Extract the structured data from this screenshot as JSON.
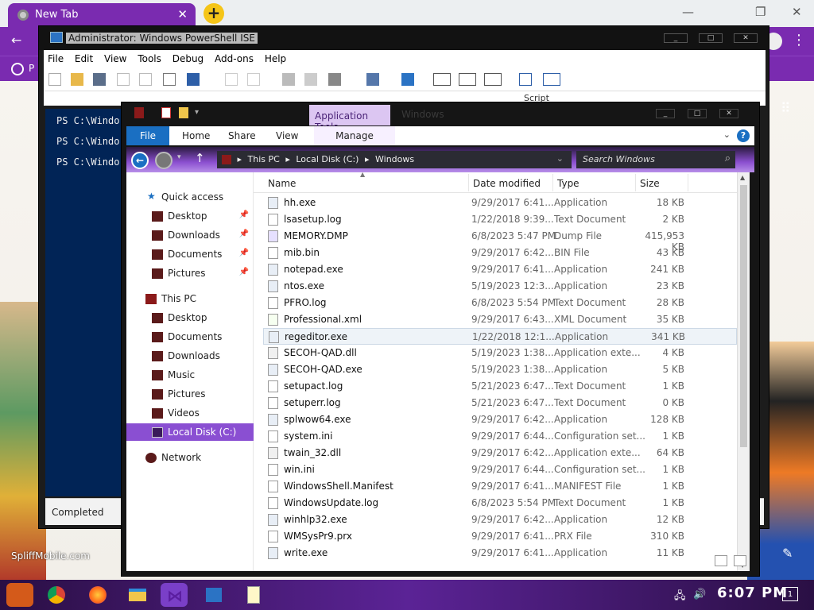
{
  "browser": {
    "tab_title": "New Tab",
    "tab_close": "✕",
    "new_tab": "+",
    "win_min": "—",
    "win_max": "❐",
    "win_close": "✕",
    "bookmark_partial": "P",
    "watermark": "SpliffMobile.com"
  },
  "ise": {
    "title": "Administrator: Windows PowerShell ISE",
    "menu": [
      "File",
      "Edit",
      "View",
      "Tools",
      "Debug",
      "Add-ons",
      "Help"
    ],
    "console_lines": [
      "PS C:\\Windo",
      "PS C:\\Windo",
      "PS C:\\Windo"
    ],
    "script_label": "Script",
    "status": "Completed"
  },
  "explorer": {
    "app_tools": "Application Tools",
    "window_title": "Windows",
    "ribbon_tabs": [
      "File",
      "Home",
      "Share",
      "View",
      "Manage"
    ],
    "help": "?",
    "breadcrumb": [
      "This PC",
      "Local Disk (C:)",
      "Windows"
    ],
    "search_placeholder": "Search Windows",
    "nav": {
      "quick_access": "Quick access",
      "quick_items": [
        "Desktop",
        "Downloads",
        "Documents",
        "Pictures"
      ],
      "this_pc": "This PC",
      "pc_items": [
        "Desktop",
        "Documents",
        "Downloads",
        "Music",
        "Pictures",
        "Videos",
        "Local Disk (C:)"
      ],
      "network": "Network"
    },
    "columns": {
      "name": "Name",
      "date": "Date modified",
      "type": "Type",
      "size": "Size"
    },
    "files": [
      {
        "name": "hh.exe",
        "date": "9/29/2017 6:41...",
        "type": "Application",
        "size": "18 KB"
      },
      {
        "name": "lsasetup.log",
        "date": "1/22/2018 9:39...",
        "type": "Text Document",
        "size": "2 KB"
      },
      {
        "name": "MEMORY.DMP",
        "date": "6/8/2023 5:47 PM",
        "type": "Dump File",
        "size": "415,953 KB"
      },
      {
        "name": "mib.bin",
        "date": "9/29/2017 6:42...",
        "type": "BIN File",
        "size": "43 KB"
      },
      {
        "name": "notepad.exe",
        "date": "9/29/2017 6:41...",
        "type": "Application",
        "size": "241 KB"
      },
      {
        "name": "ntos.exe",
        "date": "5/19/2023 12:3...",
        "type": "Application",
        "size": "23 KB"
      },
      {
        "name": "PFRO.log",
        "date": "6/8/2023 5:54 PM",
        "type": "Text Document",
        "size": "28 KB"
      },
      {
        "name": "Professional.xml",
        "date": "9/29/2017 6:43...",
        "type": "XML Document",
        "size": "35 KB"
      },
      {
        "name": "regeditor.exe",
        "date": "1/22/2018 12:1...",
        "type": "Application",
        "size": "341 KB"
      },
      {
        "name": "SECOH-QAD.dll",
        "date": "5/19/2023 1:38...",
        "type": "Application exte...",
        "size": "4 KB"
      },
      {
        "name": "SECOH-QAD.exe",
        "date": "5/19/2023 1:38...",
        "type": "Application",
        "size": "5 KB"
      },
      {
        "name": "setupact.log",
        "date": "5/21/2023 6:47...",
        "type": "Text Document",
        "size": "1 KB"
      },
      {
        "name": "setuperr.log",
        "date": "5/21/2023 6:47...",
        "type": "Text Document",
        "size": "0 KB"
      },
      {
        "name": "splwow64.exe",
        "date": "9/29/2017 6:42...",
        "type": "Application",
        "size": "128 KB"
      },
      {
        "name": "system.ini",
        "date": "9/29/2017 6:44...",
        "type": "Configuration set...",
        "size": "1 KB"
      },
      {
        "name": "twain_32.dll",
        "date": "9/29/2017 6:42...",
        "type": "Application exte...",
        "size": "64 KB"
      },
      {
        "name": "win.ini",
        "date": "9/29/2017 6:44...",
        "type": "Configuration set...",
        "size": "1 KB"
      },
      {
        "name": "WindowsShell.Manifest",
        "date": "9/29/2017 6:41...",
        "type": "MANIFEST File",
        "size": "1 KB"
      },
      {
        "name": "WindowsUpdate.log",
        "date": "6/8/2023 5:54 PM",
        "type": "Text Document",
        "size": "1 KB"
      },
      {
        "name": "winhlp32.exe",
        "date": "9/29/2017 6:42...",
        "type": "Application",
        "size": "12 KB"
      },
      {
        "name": "WMSysPr9.prx",
        "date": "9/29/2017 6:41...",
        "type": "PRX File",
        "size": "310 KB"
      },
      {
        "name": "write.exe",
        "date": "9/29/2017 6:41...",
        "type": "Application",
        "size": "11 KB"
      }
    ],
    "selected_file": "regeditor.exe"
  },
  "taskbar": {
    "clock": "6:07 PM",
    "notification_count": "1"
  },
  "colors": {
    "accent": "#7a2bb0",
    "selection": "#8a4fd2",
    "ribbon_file": "#1a6fc2"
  }
}
